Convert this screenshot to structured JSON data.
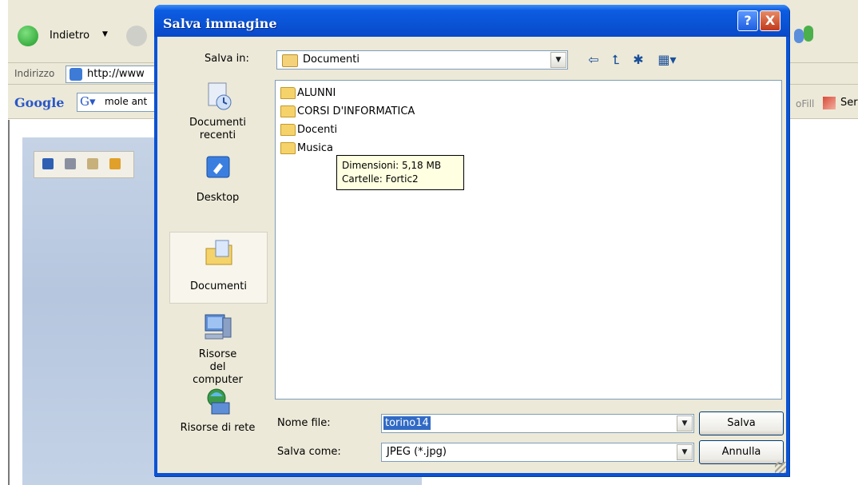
{
  "browser": {
    "back_label": "Indietro",
    "address_label": "Indirizzo",
    "address_value": "http://www",
    "google_label": "Google",
    "search_value": "mole ant",
    "right_fill_text": "oFill",
    "right_send_text": "Ser"
  },
  "dialog": {
    "title": "Salva immagine",
    "help_glyph": "?",
    "close_glyph": "X",
    "save_in_label": "Salva in:",
    "save_in_value": "Documenti"
  },
  "places": [
    {
      "label": "Documenti recenti",
      "icon": "recent-documents-icon"
    },
    {
      "label": "Desktop",
      "icon": "desktop-icon"
    },
    {
      "label": "Documenti",
      "icon": "my-documents-icon"
    },
    {
      "label": "Risorse del computer",
      "icon": "my-computer-icon"
    },
    {
      "label": "Risorse di rete",
      "icon": "network-icon"
    }
  ],
  "files": [
    "ALUNNI",
    "CORSI D'INFORMATICA",
    "Docenti",
    "Musica"
  ],
  "tooltip": {
    "line1": "Dimensioni: 5,18 MB",
    "line2": "Cartelle: Fortic2"
  },
  "filename": {
    "label": "Nome file:",
    "value": "torino14"
  },
  "filetype": {
    "label": "Salva come:",
    "value": "JPEG (*.jpg)"
  },
  "buttons": {
    "save": "Salva",
    "cancel": "Annulla"
  },
  "colors": {
    "titlebar": "#0a53d5",
    "selection": "#316ac5",
    "tooltip_bg": "#ffffe1"
  }
}
